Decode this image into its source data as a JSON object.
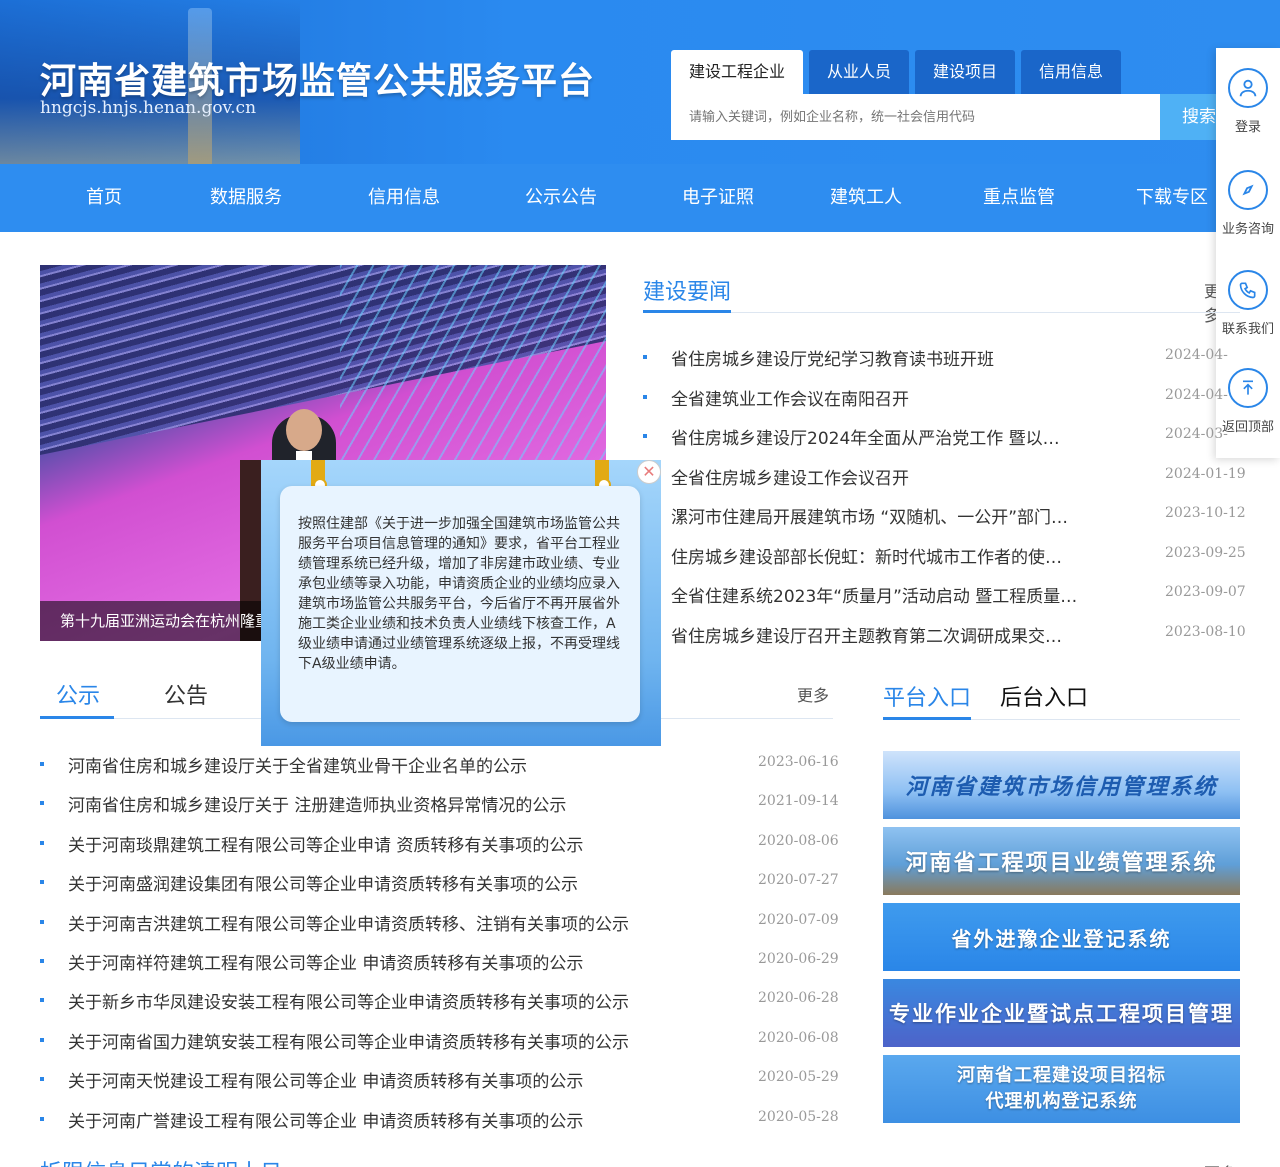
{
  "header": {
    "title": "河南省建筑市场监管公共服务平台",
    "domain": "hngcjs.hnjs.henan.gov.cn"
  },
  "search": {
    "tabs": [
      "建设工程企业",
      "从业人员",
      "建设项目",
      "信用信息"
    ],
    "placeholder": "请输入关键词，例如企业名称，统一社会信用代码",
    "button": "搜索"
  },
  "nav": [
    "首页",
    "数据服务",
    "信用信息",
    "公示公告",
    "电子证照",
    "建筑工人",
    "重点监管",
    "下载专区"
  ],
  "sidebar": {
    "items": [
      "登录",
      "业务咨询",
      "联系我们",
      "返回顶部"
    ]
  },
  "carousel": {
    "caption": "第十九届亚洲运动会在杭州隆重开幕"
  },
  "popup": {
    "text": "按照住建部《关于进一步加强全国建筑市场监管公共服务平台项目信息管理的通知》要求，省平台工程业绩管理系统已经升级，增加了非房建市政业绩、专业承包业绩等录入功能，申请资质企业的业绩均应录入建筑市场监管公共服务平台，今后省厅不再开展省外施工类企业业绩和技术负责人业绩线下核查工作，A级业绩申请通过业绩管理系统逐级上报，不再受理线下A级业绩申请。"
  },
  "news": {
    "title": "建设要闻",
    "more": "更多",
    "items": [
      {
        "text": "省住房城乡建设厅党纪学习教育读书班开班",
        "date": "2024-04-"
      },
      {
        "text": "全省建筑业工作会议在南阳召开",
        "date": "2024-04-"
      },
      {
        "text": "省住房城乡建设厅2024年全面从严治党工作 暨以…",
        "date": "2024-03-"
      },
      {
        "text": "全省住房城乡建设工作会议召开",
        "date": "2024-01-19"
      },
      {
        "text": "漯河市住建局开展建筑市场 “双随机、一公开”部门…",
        "date": "2023-10-12"
      },
      {
        "text": "住房城乡建设部部长倪虹：新时代城市工作者的使…",
        "date": "2023-09-25"
      },
      {
        "text": "全省住建系统2023年“质量月”活动启动 暨工程质量…",
        "date": "2023-09-07"
      },
      {
        "text": "省住房城乡建设厅召开主题教育第二次调研成果交…",
        "date": "2023-08-10"
      }
    ]
  },
  "notice": {
    "tabs": [
      "公示",
      "公告"
    ],
    "more": "更多",
    "items": [
      {
        "text": "河南省住房和城乡建设厅关于全省建筑业骨干企业名单的公示",
        "date": "2023-06-16"
      },
      {
        "text": "河南省住房和城乡建设厅关于 注册建造师执业资格异常情况的公示",
        "date": "2021-09-14"
      },
      {
        "text": "关于河南琰鼎建筑工程有限公司等企业申请 资质转移有关事项的公示",
        "date": "2020-08-06"
      },
      {
        "text": "关于河南盛润建设集团有限公司等企业申请资质转移有关事项的公示",
        "date": "2020-07-27"
      },
      {
        "text": "关于河南吉洪建筑工程有限公司等企业申请资质转移、注销有关事项的公示",
        "date": "2020-07-09"
      },
      {
        "text": "关于河南祥符建筑工程有限公司等企业 申请资质转移有关事项的公示",
        "date": "2020-06-29"
      },
      {
        "text": "关于新乡市华凤建设安装工程有限公司等企业申请资质转移有关事项的公示",
        "date": "2020-06-28"
      },
      {
        "text": "关于河南省国力建筑安装工程有限公司等企业申请资质转移有关事项的公示",
        "date": "2020-06-08"
      },
      {
        "text": "关于河南天悦建设工程有限公司等企业 申请资质转移有关事项的公示",
        "date": "2020-05-29"
      },
      {
        "text": "关于河南广誉建设工程有限公司等企业 申请资质转移有关事项的公示",
        "date": "2020-05-28"
      }
    ]
  },
  "platform": {
    "tabs": [
      "平台入口",
      "后台入口"
    ],
    "banners": [
      "河南省建筑市场信用管理系统",
      "河南省工程项目业绩管理系统",
      "省外进豫企业登记系统",
      "专业作业企业暨试点工程项目管理",
      "河南省工程建设项目招标",
      "代理机构登记系统"
    ]
  },
  "footer": {
    "title": "拆限信息目常的清明十日",
    "more": "更多"
  },
  "colors": {
    "accent": "#2a86e8",
    "nav": "#2e8df0",
    "header": "#1c6fd6"
  }
}
